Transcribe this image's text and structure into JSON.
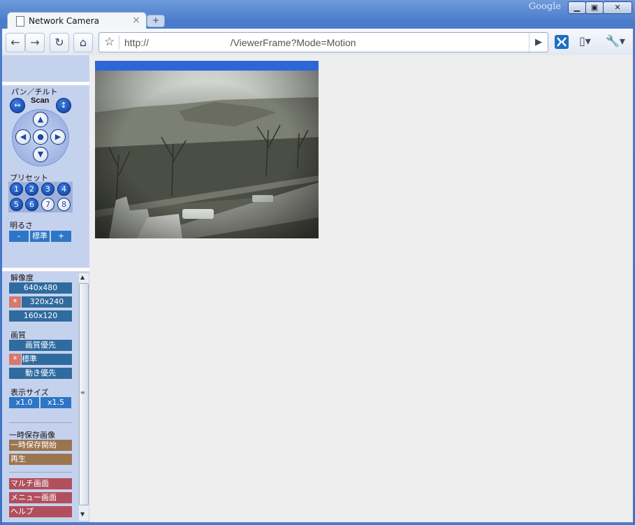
{
  "window": {
    "brand": "Google",
    "controls": {
      "minimize": "▁",
      "restore": "▣",
      "close": "✕"
    }
  },
  "tab": {
    "title": "Network Camera",
    "close": "×",
    "new_tab": "+"
  },
  "toolbar": {
    "back": "←",
    "forward": "→",
    "reload": "↻",
    "home": "⌂",
    "star": "☆",
    "url": "http://                              /ViewerFrame?Mode=Motion",
    "go": "▶",
    "page_menu": "▯▾",
    "wrench_menu": "🔧▾"
  },
  "sidebar": {
    "pantilt_label": "パン／チルト",
    "scan_label": "Scan",
    "scan_h_icon": "↔",
    "scan_v_icon": "↕",
    "dpad": {
      "up": "▲",
      "down": "▼",
      "left": "◀",
      "right": "▶",
      "home": "●"
    },
    "preset_label": "プリセット",
    "presets": [
      "1",
      "2",
      "3",
      "4",
      "5",
      "6",
      "7",
      "8"
    ],
    "brightness_label": "明るさ",
    "brightness": {
      "minus": "–",
      "normal": "標準",
      "plus": "+"
    },
    "resolution_label": "解像度",
    "resolutions": [
      "640x480",
      "320x240",
      "160x120"
    ],
    "resolution_selected_mark": "*",
    "quality_label": "画質",
    "qualities": [
      "画質優先",
      "標準",
      "動き優先"
    ],
    "quality_selected_mark": "*",
    "display_size_label": "表示サイズ",
    "display_sizes": [
      "x1.0",
      "x1.5"
    ],
    "buffer_label": "一時保存画像",
    "buffer_start": "一時保存開始",
    "playback": "再生",
    "multi_screen": "マルチ画面",
    "menu_screen": "メニュー画面",
    "help": "ヘルプ",
    "scroll_up": "▲",
    "scroll_down": "▼",
    "scroll_grip": "≡"
  }
}
